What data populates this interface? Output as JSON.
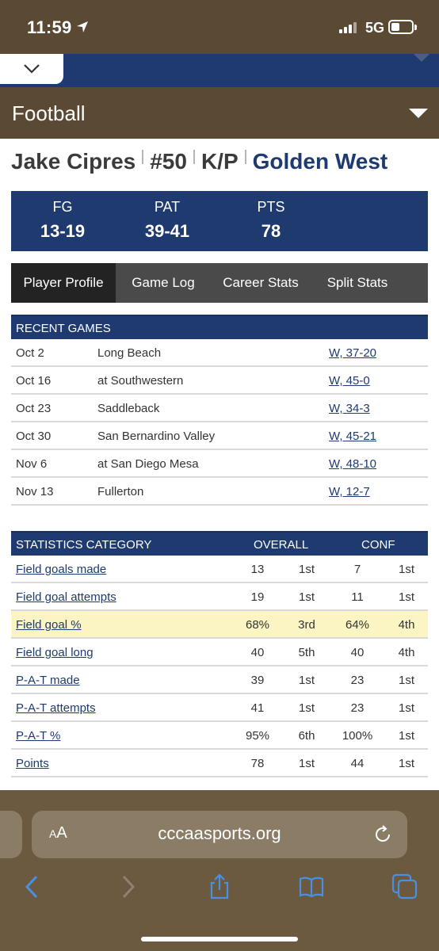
{
  "status_bar": {
    "time": "11:59",
    "network": "5G"
  },
  "sport": {
    "title": "Football"
  },
  "player": {
    "name": "Jake Cipres",
    "number": "#50",
    "position": "K/P",
    "team": "Golden West"
  },
  "summary": [
    {
      "label": "FG",
      "value": "13-19"
    },
    {
      "label": "PAT",
      "value": "39-41"
    },
    {
      "label": "PTS",
      "value": "78"
    }
  ],
  "tabs": [
    {
      "label": "Player Profile",
      "active": true
    },
    {
      "label": "Game Log",
      "active": false
    },
    {
      "label": "Career Stats",
      "active": false
    },
    {
      "label": "Split Stats",
      "active": false
    }
  ],
  "recent_games": {
    "header": "RECENT GAMES",
    "rows": [
      {
        "date": "Oct 2",
        "opponent": "Long Beach",
        "result": "W, 37-20"
      },
      {
        "date": "Oct 16",
        "opponent": "at Southwestern",
        "result": "W, 45-0"
      },
      {
        "date": "Oct 23",
        "opponent": "Saddleback",
        "result": "W, 34-3"
      },
      {
        "date": "Oct 30",
        "opponent": "San Bernardino Valley",
        "result": "W, 45-21"
      },
      {
        "date": "Nov 6",
        "opponent": "at San Diego Mesa",
        "result": "W, 48-10"
      },
      {
        "date": "Nov 13",
        "opponent": "Fullerton",
        "result": "W, 12-7"
      }
    ]
  },
  "statistics": {
    "header_category": "STATISTICS CATEGORY",
    "header_overall": "OVERALL",
    "header_conf": "CONF",
    "rows": [
      {
        "category": "Field goals made",
        "overall": "13",
        "overall_rank": "1st",
        "conf": "7",
        "conf_rank": "1st",
        "highlight": false
      },
      {
        "category": "Field goal attempts",
        "overall": "19",
        "overall_rank": "1st",
        "conf": "11",
        "conf_rank": "1st",
        "highlight": false
      },
      {
        "category": "Field goal %",
        "overall": "68%",
        "overall_rank": "3rd",
        "conf": "64%",
        "conf_rank": "4th",
        "highlight": true
      },
      {
        "category": "Field goal long",
        "overall": "40",
        "overall_rank": "5th",
        "conf": "40",
        "conf_rank": "4th",
        "highlight": false
      },
      {
        "category": "P-A-T made",
        "overall": "39",
        "overall_rank": "1st",
        "conf": "23",
        "conf_rank": "1st",
        "highlight": false
      },
      {
        "category": "P-A-T attempts",
        "overall": "41",
        "overall_rank": "1st",
        "conf": "23",
        "conf_rank": "1st",
        "highlight": false
      },
      {
        "category": "P-A-T %",
        "overall": "95%",
        "overall_rank": "6th",
        "conf": "100%",
        "conf_rank": "1st",
        "highlight": false
      },
      {
        "category": "Points",
        "overall": "78",
        "overall_rank": "1st",
        "conf": "44",
        "conf_rank": "1st",
        "highlight": false
      }
    ]
  },
  "browser": {
    "text_size_label_small": "A",
    "text_size_label_large": "A",
    "url": "cccaasports.org"
  },
  "colors": {
    "brown": "#5b4a33",
    "navy": "#1e3a6e",
    "highlight": "#fbf5c4"
  }
}
